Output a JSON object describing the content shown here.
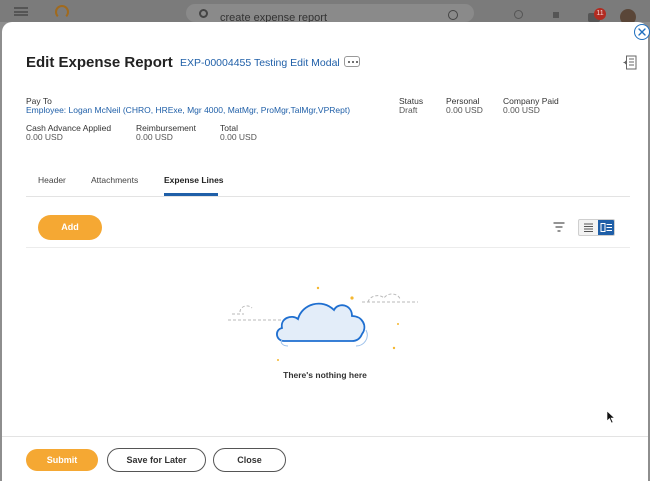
{
  "background": {
    "search_text": "create expense report",
    "notification_count": "11"
  },
  "modal": {
    "title": "Edit Expense Report",
    "report_id": "EXP-00004455 Testing Edit Modal"
  },
  "summary": {
    "pay_to_label": "Pay To",
    "pay_to_value": "Employee: Logan McNeil (CHRO, HRExe, Mgr 4000, MatMgr, ProMgr,TalMgr,VPRept)",
    "status_label": "Status",
    "status_value": "Draft",
    "personal_label": "Personal",
    "personal_value": "0.00 USD",
    "company_paid_label": "Company Paid",
    "company_paid_value": "0.00 USD",
    "cash_advance_label": "Cash Advance Applied",
    "cash_advance_value": "0.00 USD",
    "reimbursement_label": "Reimbursement",
    "reimbursement_value": "0.00 USD",
    "total_label": "Total",
    "total_value": "0.00 USD"
  },
  "tabs": [
    {
      "label": "Header"
    },
    {
      "label": "Attachments"
    },
    {
      "label": "Expense Lines"
    }
  ],
  "toolbar": {
    "add_label": "Add"
  },
  "empty_state": {
    "message": "There's nothing here"
  },
  "footer": {
    "submit_label": "Submit",
    "save_later_label": "Save for Later",
    "close_label": "Close"
  },
  "colors": {
    "accent": "#f5a833",
    "link": "#1f5fa8"
  }
}
